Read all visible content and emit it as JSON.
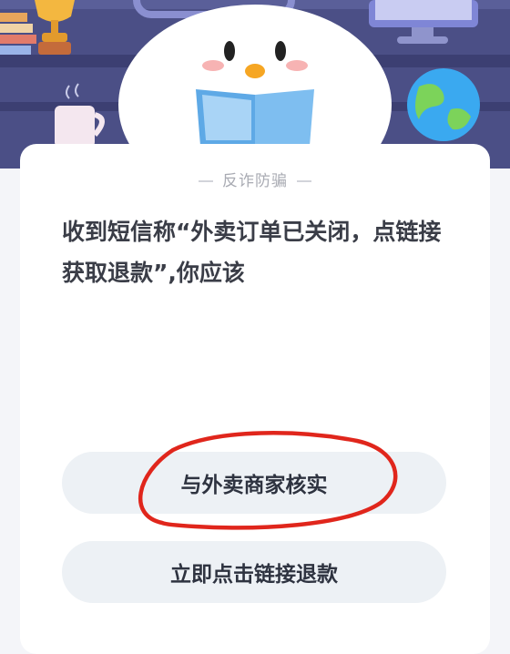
{
  "section_label": "反诈防骗",
  "question": "收到短信称“外卖订单已关闭，点链接获取退款”,你应该",
  "options": [
    {
      "label": "与外卖商家核实"
    },
    {
      "label": "立即点击链接退款"
    }
  ],
  "colors": {
    "hero_bg": "#4b4f86",
    "option_bg": "#edf1f5",
    "annotation": "#e0261c"
  }
}
